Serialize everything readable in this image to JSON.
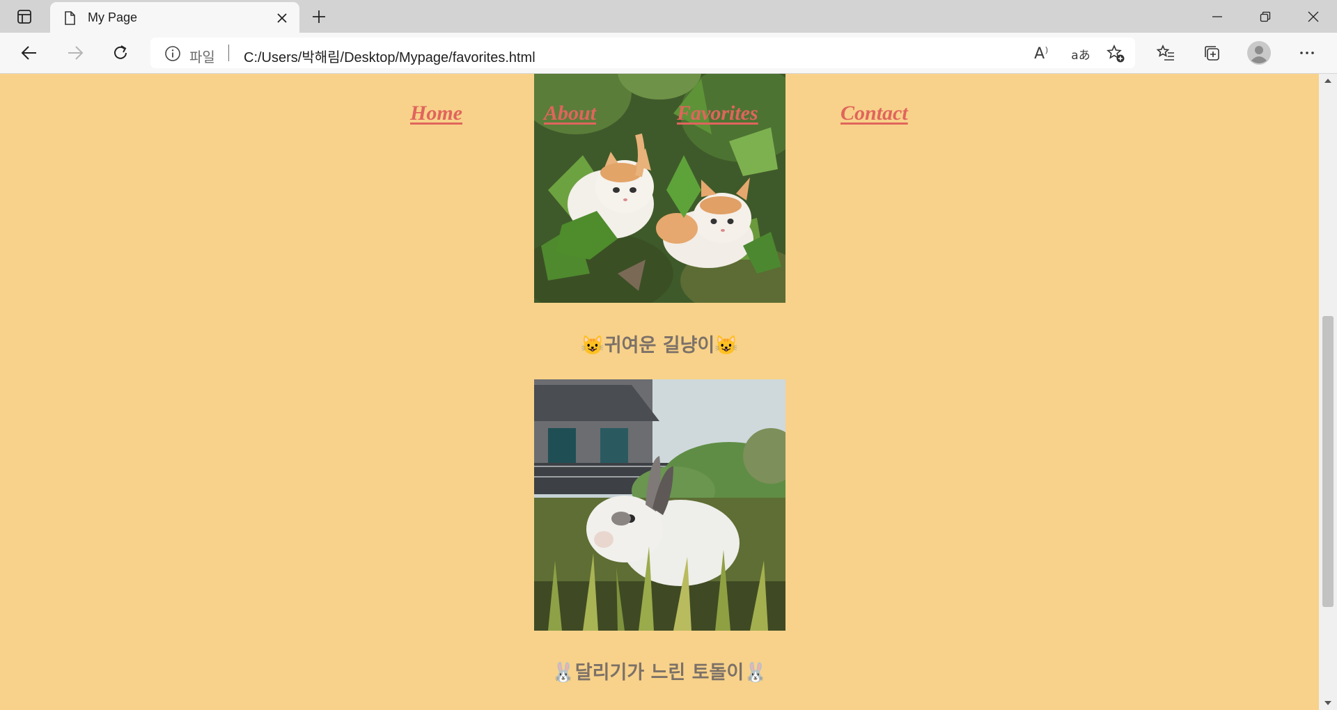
{
  "browser": {
    "tab": {
      "title": "My Page",
      "favicon": "page-icon"
    },
    "address": {
      "scheme": "파일",
      "url": "C:/Users/박해림/Desktop/Mypage/favorites.html"
    },
    "icons": [
      "tab-actions-icon",
      "close-icon",
      "plus-icon",
      "minimize-icon",
      "restore-icon",
      "close-window-icon",
      "back-icon",
      "forward-icon",
      "refresh-icon",
      "info-icon",
      "read-aloud-icon",
      "translate-icon",
      "add-favorite-icon",
      "favorites-icon",
      "collections-icon",
      "profile-icon",
      "more-icon"
    ],
    "read_aloud_glyph": "A",
    "translate_glyph": "aあ"
  },
  "page": {
    "nav": {
      "home": "Home",
      "about": "About",
      "favorites": "Favorites",
      "contact": "Contact"
    },
    "items": [
      {
        "caption": "😺귀여운 길냥이😺",
        "image": "two orange-and-white kittens among green plants"
      },
      {
        "caption": "🐰달리기가 느린 토돌이🐰",
        "image": "white rabbit with dark ears in grass in front of a house"
      }
    ],
    "colors": {
      "background": "#f8d28a",
      "nav_link": "#e0655c",
      "caption": "#7c7168"
    }
  }
}
